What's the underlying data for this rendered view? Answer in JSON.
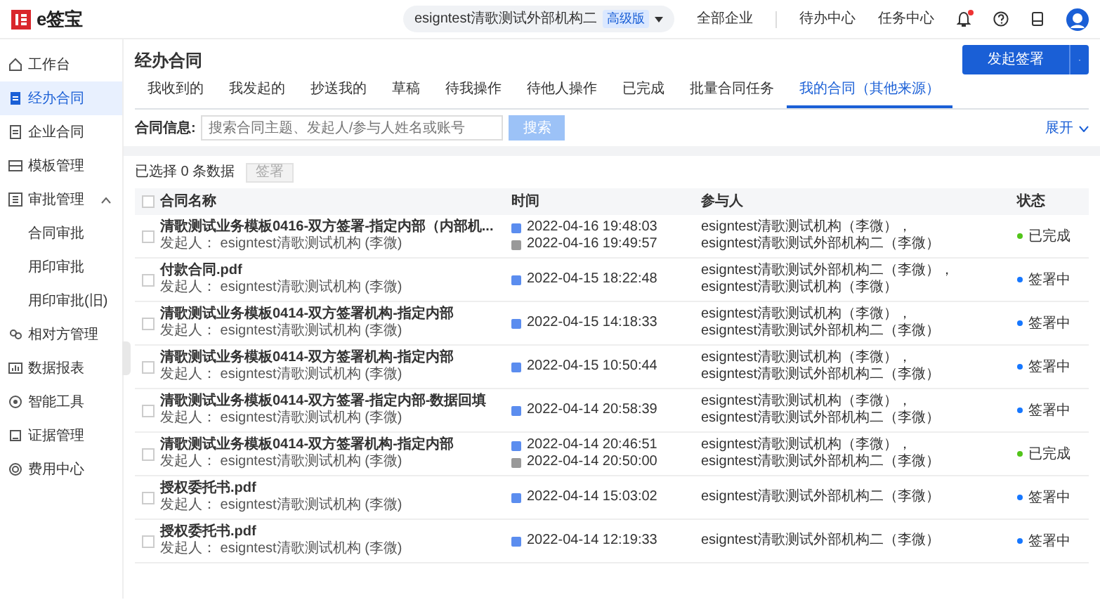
{
  "topbar": {
    "logo_text": "e签宝",
    "org_name": "esigntest清歌测试外部机构二",
    "org_badge": "高级版",
    "links": [
      "全部企业",
      "待办中心",
      "任务中心"
    ],
    "has_unread": true
  },
  "sidebar": {
    "items": [
      {
        "label": "工作台",
        "selected": false
      },
      {
        "label": "经办合同",
        "selected": true
      },
      {
        "label": "企业合同",
        "selected": false
      },
      {
        "label": "模板管理",
        "selected": false
      },
      {
        "label": "审批管理",
        "selected": false,
        "expanded": true,
        "children": [
          {
            "label": "合同审批",
            "selected": false
          },
          {
            "label": "用印审批",
            "selected": false
          },
          {
            "label": "用印审批(旧)",
            "selected": false
          }
        ]
      },
      {
        "label": "相对方管理",
        "selected": false
      },
      {
        "label": "数据报表",
        "selected": false
      },
      {
        "label": "智能工具",
        "selected": false
      },
      {
        "label": "证据管理",
        "selected": false
      },
      {
        "label": "费用中心",
        "selected": false
      }
    ]
  },
  "page_title": "经办合同",
  "primary_button": "发起签署",
  "tabs": [
    {
      "label": "我收到的",
      "selected": false
    },
    {
      "label": "我发起的",
      "selected": false
    },
    {
      "label": "抄送我的",
      "selected": false
    },
    {
      "label": "草稿",
      "selected": false
    },
    {
      "label": "待我操作",
      "selected": false
    },
    {
      "label": "待他人操作",
      "selected": false
    },
    {
      "label": "已完成",
      "selected": false
    },
    {
      "label": "批量合同任务",
      "selected": false
    },
    {
      "label": "我的合同（其他来源）",
      "selected": true
    }
  ],
  "filter": {
    "label": "合同信息:",
    "placeholder": "搜索合同主题、发起人/参与人姓名或账号",
    "search_button": "搜索",
    "expand_link": "展开"
  },
  "selection": {
    "summary": "已选择 0 条数据",
    "batch_button": "签署",
    "batch_disabled": true
  },
  "table": {
    "all_selected": false,
    "columns": [
      "合同名称",
      "时间",
      "参与人",
      "状态"
    ],
    "rows": [
      {
        "checked": false,
        "title": "清歌测试业务模板0416-双方签署-指定内部（内部机...",
        "sender": "发起人： esigntest清歌测试机构 (李微)",
        "times": [
          {
            "kind": "start",
            "text": "2022-04-16 19:48:03"
          },
          {
            "kind": "end",
            "text": "2022-04-16 19:49:57"
          }
        ],
        "participants": [
          "esigntest清歌测试机构（李微），",
          "esigntest清歌测试外部机构二（李微）"
        ],
        "status": {
          "text": "已完成",
          "color": "#52c41a"
        }
      },
      {
        "checked": false,
        "title": "付款合同.pdf",
        "sender": "发起人： esigntest清歌测试机构 (李微)",
        "times": [
          {
            "kind": "start",
            "text": "2022-04-15 18:22:48"
          }
        ],
        "participants": [
          "esigntest清歌测试外部机构二（李微），",
          "esigntest清歌测试机构（李微）"
        ],
        "status": {
          "text": "签署中",
          "color": "#1677ff"
        }
      },
      {
        "checked": false,
        "title": "清歌测试业务模板0414-双方签署机构-指定内部",
        "sender": "发起人： esigntest清歌测试机构 (李微)",
        "times": [
          {
            "kind": "start",
            "text": "2022-04-15 14:18:33"
          }
        ],
        "participants": [
          "esigntest清歌测试机构（李微），",
          "esigntest清歌测试外部机构二（李微）"
        ],
        "status": {
          "text": "签署中",
          "color": "#1677ff"
        }
      },
      {
        "checked": false,
        "title": "清歌测试业务模板0414-双方签署机构-指定内部",
        "sender": "发起人： esigntest清歌测试机构 (李微)",
        "times": [
          {
            "kind": "start",
            "text": "2022-04-15 10:50:44"
          }
        ],
        "participants": [
          "esigntest清歌测试机构（李微），",
          "esigntest清歌测试外部机构二（李微）"
        ],
        "status": {
          "text": "签署中",
          "color": "#1677ff"
        }
      },
      {
        "checked": false,
        "title": "清歌测试业务模板0414-双方签署-指定内部-数据回填",
        "sender": "发起人： esigntest清歌测试机构 (李微)",
        "times": [
          {
            "kind": "start",
            "text": "2022-04-14 20:58:39"
          }
        ],
        "participants": [
          "esigntest清歌测试机构（李微），",
          "esigntest清歌测试外部机构二（李微）"
        ],
        "status": {
          "text": "签署中",
          "color": "#1677ff"
        }
      },
      {
        "checked": false,
        "title": "清歌测试业务模板0414-双方签署机构-指定内部",
        "sender": "发起人： esigntest清歌测试机构 (李微)",
        "times": [
          {
            "kind": "start",
            "text": "2022-04-14 20:46:51"
          },
          {
            "kind": "end",
            "text": "2022-04-14 20:50:00"
          }
        ],
        "participants": [
          "esigntest清歌测试机构（李微），",
          "esigntest清歌测试外部机构二（李微）"
        ],
        "status": {
          "text": "已完成",
          "color": "#52c41a"
        }
      },
      {
        "checked": false,
        "title": "授权委托书.pdf",
        "sender": "发起人： esigntest清歌测试机构 (李微)",
        "times": [
          {
            "kind": "start",
            "text": "2022-04-14 15:03:02"
          }
        ],
        "participants": [
          "esigntest清歌测试外部机构二（李微）"
        ],
        "status": {
          "text": "签署中",
          "color": "#1677ff"
        }
      },
      {
        "checked": false,
        "title": "授权委托书.pdf",
        "sender": "发起人： esigntest清歌测试机构 (李微)",
        "times": [
          {
            "kind": "start",
            "text": "2022-04-14 12:19:33"
          }
        ],
        "participants": [
          "esigntest清歌测试外部机构二（李微）"
        ],
        "status": {
          "text": "签署中",
          "color": "#1677ff"
        }
      }
    ]
  }
}
